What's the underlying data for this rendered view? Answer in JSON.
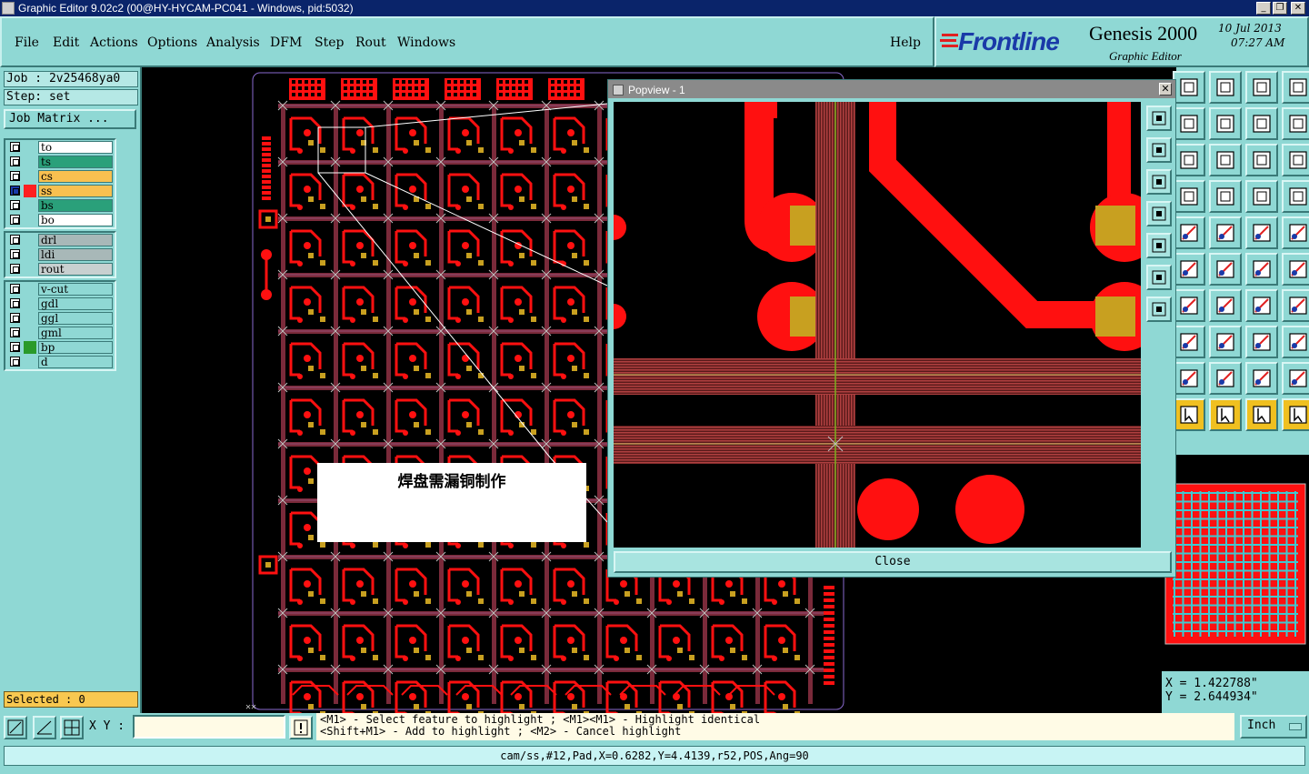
{
  "window": {
    "title": "Graphic Editor 9.02c2 (00@HY-HYCAM-PC041 - Windows, pid:5032)"
  },
  "menu": {
    "items": [
      "File",
      "Edit",
      "Actions",
      "Options",
      "Analysis",
      "DFM",
      "Step",
      "Rout",
      "Windows"
    ],
    "help": "Help"
  },
  "brand": {
    "logo": "Frontline",
    "product": "Genesis 2000",
    "subtitle": "Graphic Editor",
    "date": "10 Jul 2013",
    "time": "07:27 AM",
    "logo_color": "#1a3aa8"
  },
  "job": {
    "job_label": "Job : 2v25468ya0",
    "step_label": "Step: set",
    "matrix_button": "Job Matrix ..."
  },
  "layers": {
    "group1": [
      {
        "name": "to",
        "color": "#ffffff",
        "marker": ""
      },
      {
        "name": "ts",
        "color": "#2aa07a",
        "marker": ""
      },
      {
        "name": "cs",
        "color": "#f8c050",
        "marker": ""
      },
      {
        "name": "ss",
        "color": "#f8c050",
        "marker": "#ff2020"
      },
      {
        "name": "bs",
        "color": "#2aa07a",
        "marker": ""
      },
      {
        "name": "bo",
        "color": "#ffffff",
        "marker": ""
      }
    ],
    "group2": [
      {
        "name": "drl",
        "color": "#a8b8b8",
        "marker": ""
      },
      {
        "name": "ldi",
        "color": "#a8b8b8",
        "marker": ""
      },
      {
        "name": "rout",
        "color": "#c8d0d0",
        "marker": ""
      }
    ],
    "group3": [
      {
        "name": "v-cut",
        "color": "#8fd8d4",
        "marker": ""
      },
      {
        "name": "gdl",
        "color": "#8fd8d4",
        "marker": ""
      },
      {
        "name": "ggl",
        "color": "#8fd8d4",
        "marker": ""
      },
      {
        "name": "gml",
        "color": "#8fd8d4",
        "marker": ""
      },
      {
        "name": "bp",
        "color": "#8fd8d4",
        "marker": "#2a9a2a"
      },
      {
        "name": "d",
        "color": "#8fd8d4",
        "marker": ""
      }
    ]
  },
  "selection": {
    "label": "Selected : 0"
  },
  "canvas": {
    "annotation": "焊盘需漏铜制作"
  },
  "popview": {
    "title": "Popview - 1",
    "close_button": "Close"
  },
  "coords": {
    "x": "X  = 1.422788\"",
    "y": "Y  = 2.644934\""
  },
  "bottom": {
    "xy_label": "X Y :",
    "xy_value": "",
    "help_line1": "<M1> - Select feature to highlight ; <M1><M1> - Highlight identical",
    "help_line2": "<Shift+M1> - Add to highlight ; <M2> - Cancel highlight",
    "units": "Inch"
  },
  "status": {
    "text": "cam/ss,#12,Pad,X=0.6282,Y=4.4139,r52,POS,Ang=90"
  },
  "colors": {
    "panel": "#8fd8d4",
    "copper": "#ff1010",
    "pad": "#c8a020",
    "hatch": "#b04040"
  }
}
